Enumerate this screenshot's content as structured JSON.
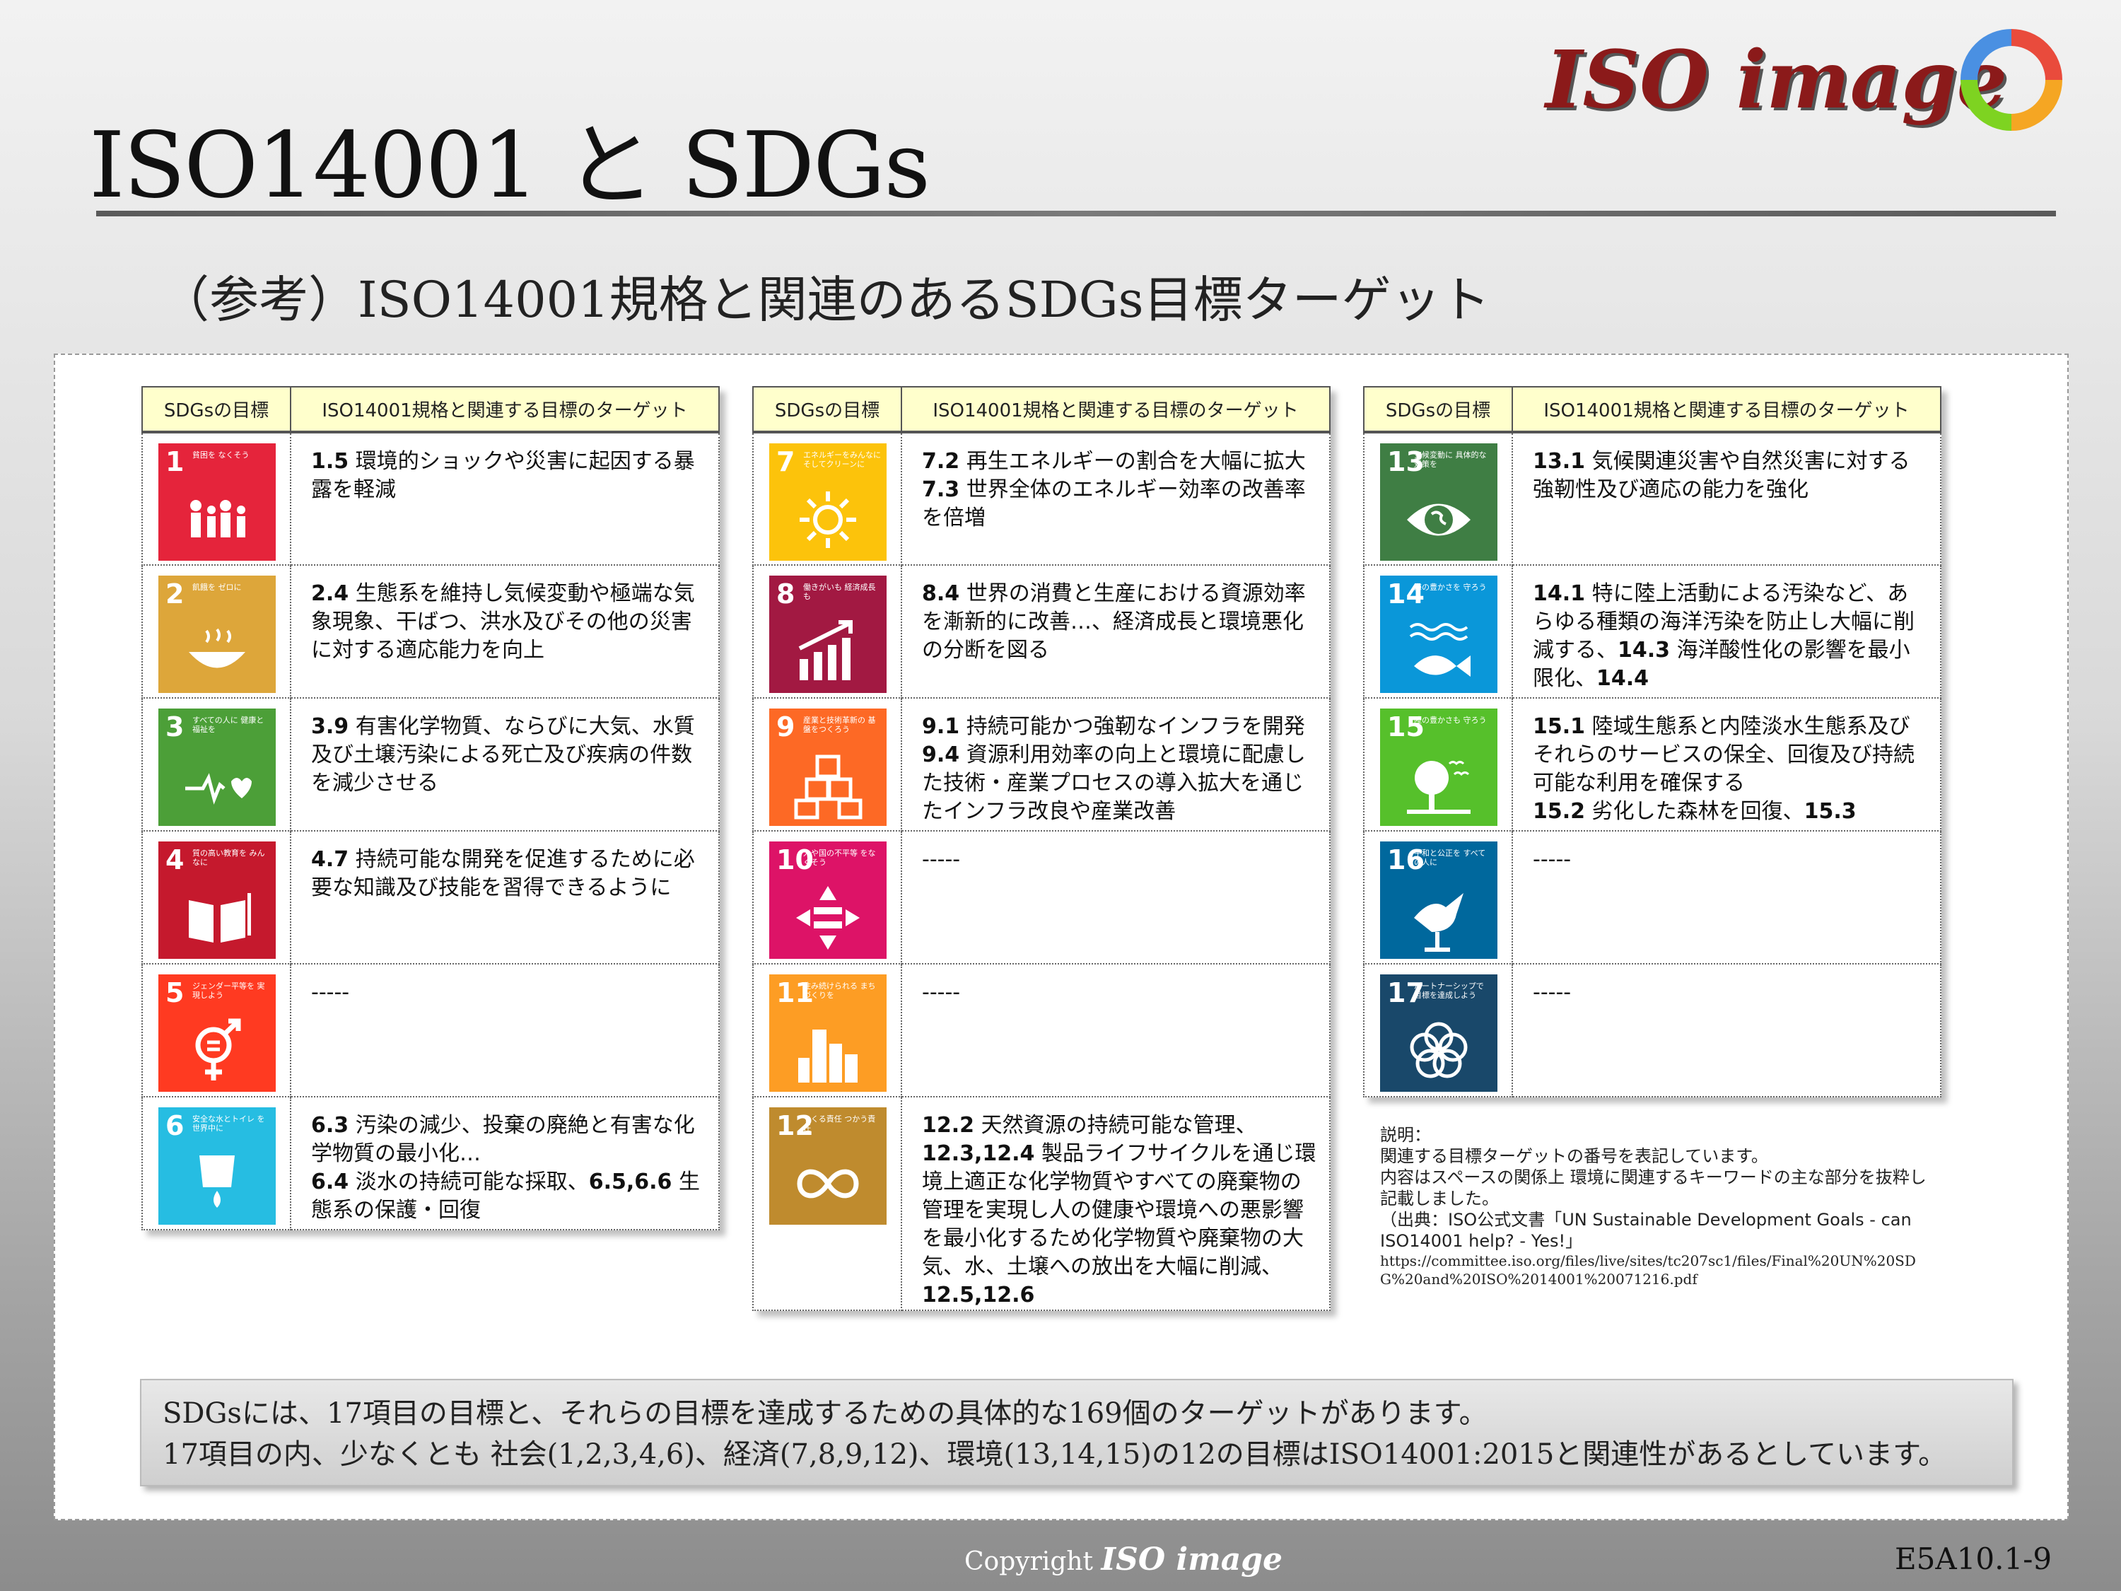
{
  "title": "ISO14001 と SDGs",
  "logo": {
    "text": "ISO image",
    "ring_colors": [
      "#e94b3c",
      "#f5a623",
      "#7ed321",
      "#4a90e2"
    ]
  },
  "subtitle": "（参考）ISO14001規格と関連のあるSDGs目標ターゲット",
  "table_headers": {
    "goal": "SDGsの目標",
    "target": "ISO14001規格と関連する目標のターゲット"
  },
  "columns": [
    [
      {
        "num": "1",
        "label": "貧困を なくそう",
        "color": "#e5243b",
        "icon": "people-icon",
        "parts": [
          [
            "1.5",
            " 環境的ショックや災害に起因する暴露を軽減"
          ]
        ]
      },
      {
        "num": "2",
        "label": "飢餓を ゼロに",
        "color": "#dda63a",
        "icon": "bowl-icon",
        "parts": [
          [
            "2.4",
            " 生態系を維持し気候変動や極端な気象現象、干ばつ、洪水及びその他の災害に対する適応能力を向上"
          ]
        ]
      },
      {
        "num": "3",
        "label": "すべての人に 健康と福祉を",
        "color": "#4c9f38",
        "icon": "heartbeat-icon",
        "parts": [
          [
            "3.9",
            " 有害化学物質、ならびに大気、水質及び土壌汚染による死亡及び疾病の件数を減少させる"
          ]
        ]
      },
      {
        "num": "4",
        "label": "質の高い教育を みんなに",
        "color": "#c5192d",
        "icon": "book-icon",
        "parts": [
          [
            "4.7",
            " 持続可能な開発を促進するために必要な知識及び技能を習得できるように"
          ]
        ]
      },
      {
        "num": "5",
        "label": "ジェンダー平等を 実現しよう",
        "color": "#ff3a21",
        "icon": "gender-icon",
        "parts": [
          [
            "",
            "-----"
          ]
        ]
      },
      {
        "num": "6",
        "label": "安全な水とトイレ を世界中に",
        "color": "#26bde2",
        "icon": "water-icon",
        "parts": [
          [
            "6.3",
            " 汚染の減少、投棄の廃絶と有害な化学物質の最小化…"
          ],
          [
            "6.4",
            " 淡水の持続可能な採取、"
          ],
          [
            "6.5,",
            ""
          ],
          [
            "6.6",
            " 生態系の保護・回復"
          ]
        ]
      }
    ],
    [
      {
        "num": "7",
        "label": "エネルギーをみんなに そしてクリーンに",
        "color": "#fcc30b",
        "icon": "sun-icon",
        "parts": [
          [
            "7.2",
            " 再生エネルギーの割合を大幅に拡大"
          ],
          [
            "7.3",
            " 世界全体のエネルギー効率の改善率を倍増"
          ]
        ]
      },
      {
        "num": "8",
        "label": "働きがいも 経済成長も",
        "color": "#a21942",
        "icon": "growth-chart-icon",
        "parts": [
          [
            "8.4",
            " 世界の消費と生産における資源効率を漸新的に改善…、経済成長と環境悪化の分断を図る"
          ]
        ]
      },
      {
        "num": "9",
        "label": "産業と技術革新の 基盤をつくろう",
        "color": "#fd6925",
        "icon": "cubes-icon",
        "parts": [
          [
            "9.1",
            " 持続可能かつ強靭なインフラを開発"
          ],
          [
            "9.4",
            " 資源利用効率の向上と環境に配慮した技術・産業プロセスの導入拡大を通じたインフラ改良や産業改善"
          ]
        ]
      },
      {
        "num": "10",
        "label": "人や国の不平等 をなくそう",
        "color": "#dd1367",
        "icon": "equality-icon",
        "parts": [
          [
            "",
            "-----"
          ]
        ]
      },
      {
        "num": "11",
        "label": "住み続けられる まちづくりを",
        "color": "#fd9d24",
        "icon": "city-icon",
        "parts": [
          [
            "",
            "-----"
          ]
        ]
      },
      {
        "num": "12",
        "label": "つくる責任 つかう責任",
        "color": "#bf8b2e",
        "icon": "infinity-icon",
        "parts": [
          [
            "12.2",
            " 天然資源の持続可能な管理、"
          ],
          [
            "12.3,12.4",
            " 製品ライフサイクルを通じ環境上適正な化学物質やすべての廃棄物の管理を実現し人の健康や環境への悪影響を最小化するため化学物質や廃棄物の大気、水、土壌への放出を大幅に削減、"
          ],
          [
            "12.5,12.6",
            ""
          ]
        ]
      }
    ],
    [
      {
        "num": "13",
        "label": "気候変動に 具体的な対策を",
        "color": "#3f7e44",
        "icon": "eye-globe-icon",
        "parts": [
          [
            "13.1",
            " 気候関連災害や自然災害に対する強靭性及び適応の能力を強化"
          ]
        ]
      },
      {
        "num": "14",
        "label": "海の豊かさを 守ろう",
        "color": "#0a97d9",
        "icon": "fish-icon",
        "parts": [
          [
            "14.1",
            " 特に陸上活動による汚染など、あらゆる種類の海洋汚染を防止し大幅に削減する、"
          ],
          [
            "14.3",
            " 海洋酸性化の影響を最小限化、"
          ],
          [
            "14.4",
            ""
          ]
        ]
      },
      {
        "num": "15",
        "label": "陸の豊かさも 守ろう",
        "color": "#56c02b",
        "icon": "tree-icon",
        "parts": [
          [
            "15.1",
            " 陸域生態系と内陸淡水生態系及びそれらのサービスの保全、回復及び持続可能な利用を確保する"
          ],
          [
            "15.2",
            " 劣化した森林を回復、"
          ],
          [
            "15.3",
            ""
          ]
        ]
      },
      {
        "num": "16",
        "label": "平和と公正を すべての人に",
        "color": "#00689d",
        "icon": "dove-icon",
        "parts": [
          [
            "",
            "-----"
          ]
        ]
      },
      {
        "num": "17",
        "label": "パートナーシップで 目標を達成しよう",
        "color": "#19486a",
        "icon": "flower-icon",
        "parts": [
          [
            "",
            "-----"
          ]
        ]
      }
    ]
  ],
  "note": {
    "heading": "説明：",
    "line1": "関連する目標ターゲットの番号を表記しています。",
    "line2": "内容はスペースの関係上 環境に関連するキーワードの主な部分を抜粋し記載しました。",
    "line3": "（出典：ISO公式文書「UN Sustainable Development Goals - can ISO14001 help? - Yes!」",
    "url": "https://committee.iso.org/files/live/sites/tc207sc1/files/Final%20UN%20SDG%20and%20ISO%2014001%20071216.pdf"
  },
  "summary": {
    "line1": "SDGsには、17項目の目標と、それらの目標を達成するための具体的な169個のターゲットがあります。",
    "line2": "17項目の内、少なくとも 社会(1,2,3,4,6)、経済(7,8,9,12)、環境(13,14,15)の12の目標はISO14001:2015と関連性があるとしています。"
  },
  "footer": {
    "copyright": "Copyright",
    "brand": "ISO image"
  },
  "page_number": "E5A10.1-9"
}
